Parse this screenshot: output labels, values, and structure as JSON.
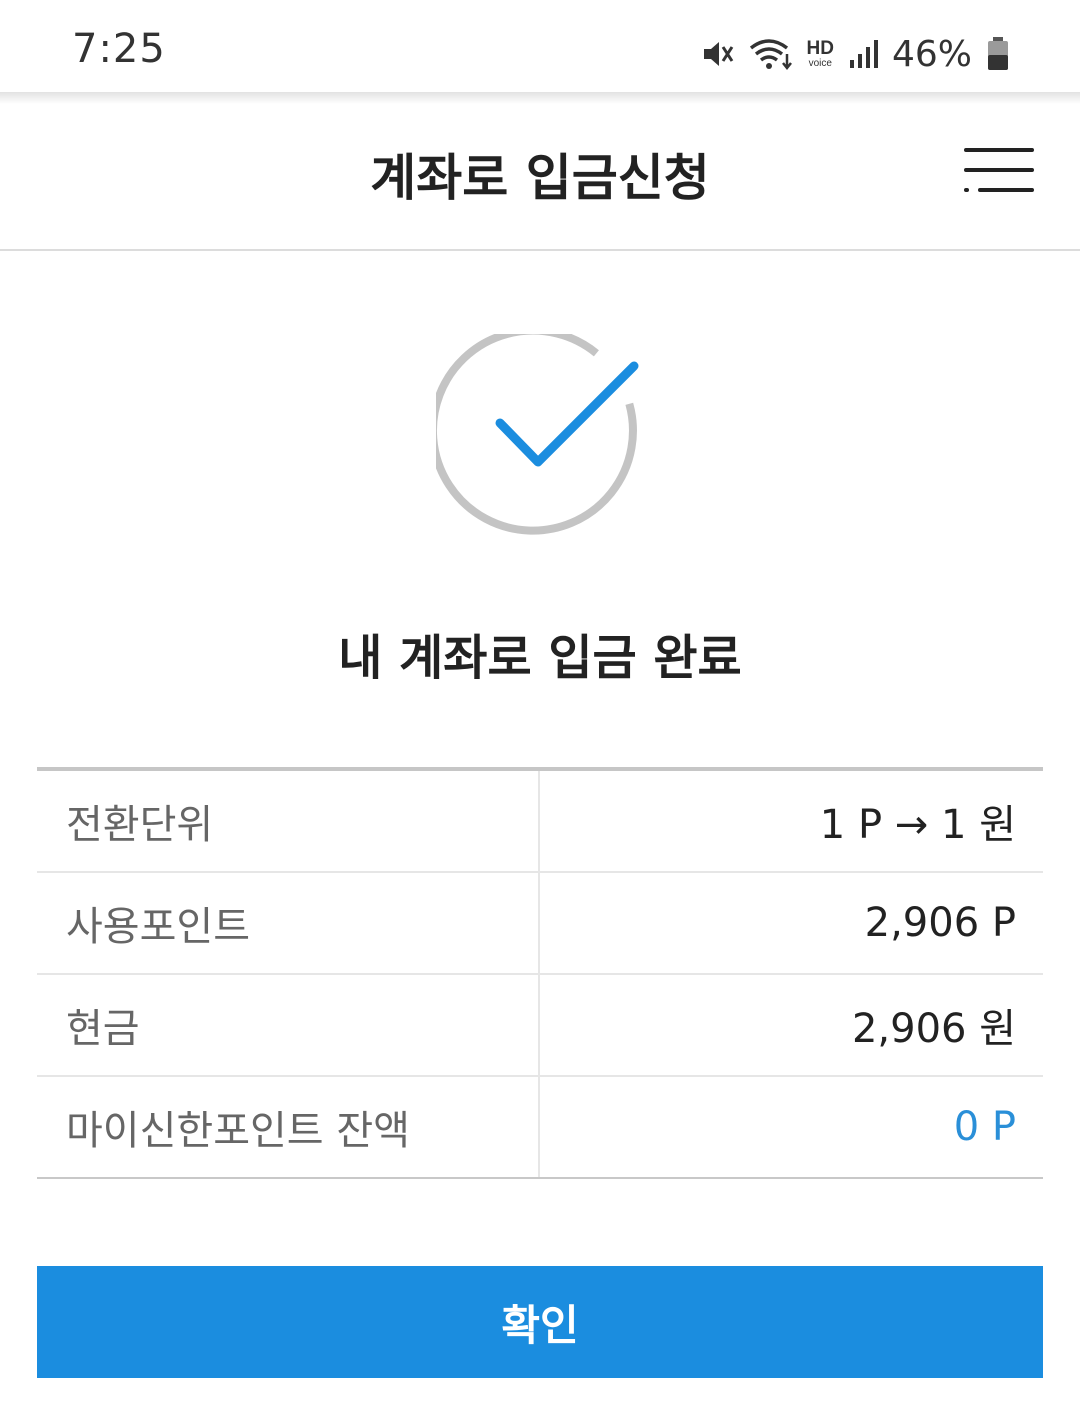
{
  "status_bar": {
    "time": "7:25",
    "hd_label": "HD",
    "voice_label": "voice",
    "battery_percent": "46%",
    "icons": [
      "mute-icon",
      "wifi-icon",
      "hd-voice-icon",
      "signal-icon",
      "battery-icon"
    ]
  },
  "header": {
    "title": "계좌로 입금신청",
    "menu_icon": "menu-icon"
  },
  "result": {
    "icon": "check-circle-icon",
    "title": "내 계좌로 입금 완료"
  },
  "table": {
    "rows": [
      {
        "label": "전환단위",
        "value": "1 P → 1 원"
      },
      {
        "label": "사용포인트",
        "value": "2,906 P"
      },
      {
        "label": "현금",
        "value": "2,906 원"
      },
      {
        "label": "마이신한포인트 잔액",
        "value": "0 P"
      }
    ]
  },
  "confirm_button": {
    "label": "확인"
  },
  "colors": {
    "accent": "#1b8ddf",
    "balance_value": "#2a8fd8",
    "check_stroke": "#1b8ddf",
    "circle_stroke": "#c4c4c4"
  }
}
